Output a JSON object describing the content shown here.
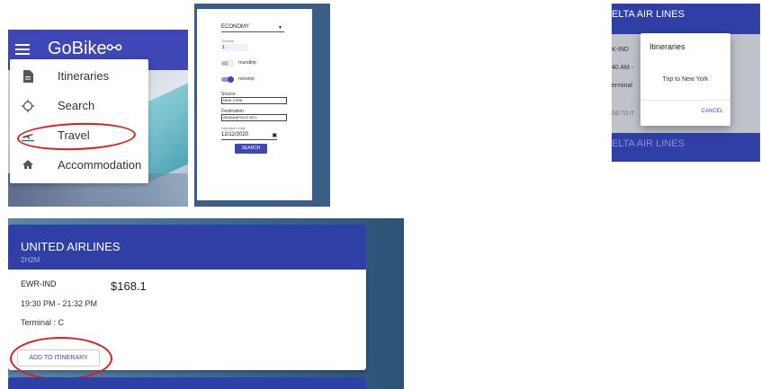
{
  "drawer": {
    "brand": "GoBike",
    "items": [
      {
        "label": "Itineraries",
        "icon": "document-icon"
      },
      {
        "label": "Search",
        "icon": "crosshair-icon"
      },
      {
        "label": "Travel",
        "icon": "flight-icon"
      },
      {
        "label": "Accommodation",
        "icon": "home-icon"
      }
    ]
  },
  "search_form": {
    "class_value": "ECONOMY",
    "traveler_label": "Traveler",
    "traveler_value": "1",
    "roundtrip_label": "roundtrip",
    "nonstop_label": "nonstop",
    "source_label": "Source",
    "source_value": "NEW YORK",
    "destination_label": "Destination",
    "destination_value": "INDIANAPOLIS INTL",
    "departure_label": "Departure Date",
    "departure_value": "12/12/2020",
    "search_button": "SEARCH"
  },
  "dialog_view": {
    "bg_title": "ELTA AIR LINES",
    "bg_route": "K-IND",
    "bg_time": "40 AM -",
    "bg_terminal": "erminal",
    "bg_add": "DD TO IT",
    "bg_next_title": "ELTA AIR LINES",
    "dialog_title": "Itineraries",
    "dialog_item": "Trip to New York",
    "cancel_button": "CANCEL"
  },
  "flight_card": {
    "airline": "UNITED AIRLINES",
    "duration": "2H2M",
    "route": "EWR-IND",
    "price": "$168.1",
    "time": "19:30 PM - 21:32 PM",
    "terminal": "Terminal : C",
    "add_button": "ADD TO ITINERARY"
  },
  "colors": {
    "primary": "#3f46b5",
    "header_blue": "#2f3fa5",
    "annotation_red": "#e01c1c"
  }
}
